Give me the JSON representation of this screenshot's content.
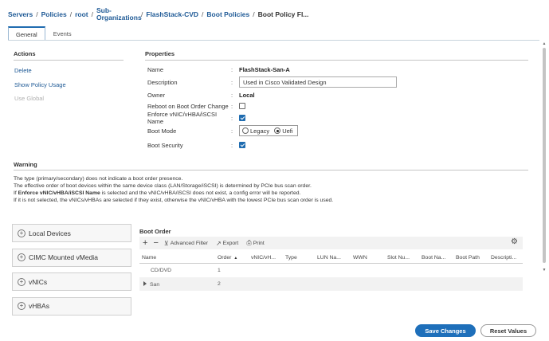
{
  "breadcrumb": {
    "items": [
      "Servers",
      "Policies",
      "root",
      "Sub-",
      "Organizations",
      "FlashStack-CVD",
      "Boot Policies",
      "Boot Policy Fl..."
    ]
  },
  "tabs": [
    {
      "label": "General",
      "active": true
    },
    {
      "label": "Events",
      "active": false
    }
  ],
  "actions": {
    "title": "Actions",
    "items": [
      {
        "label": "Delete",
        "enabled": true
      },
      {
        "label": "Show Policy Usage",
        "enabled": true
      },
      {
        "label": "Use Global",
        "enabled": false
      }
    ]
  },
  "properties": {
    "title": "Properties",
    "name_label": "Name",
    "name_value": "FlashStack-San-A",
    "description_label": "Description",
    "description_value": "Used in Cisco Validated Design",
    "owner_label": "Owner",
    "owner_value": "Local",
    "reboot_label": "Reboot on Boot Order Change",
    "reboot_checked": false,
    "enforce_label": "Enforce vNIC/vHBA/iSCSI Name",
    "enforce_checked": true,
    "boot_mode_label": "Boot Mode",
    "boot_mode_options": [
      "Legacy",
      "Uefi"
    ],
    "boot_mode_selected": "Uefi",
    "boot_security_label": "Boot Security",
    "boot_security_checked": true,
    "colon": ":"
  },
  "warning": {
    "title": "Warning",
    "line1": "The type (primary/secondary) does not indicate a boot order presence.",
    "line2": "The effective order of boot devices within the same device class (LAN/Storage/iSCSI) is determined by PCIe bus scan order.",
    "line3_pre": "If ",
    "line3_bold": "Enforce vNIC/vHBA/iSCSI Name",
    "line3_post": " is selected and the vNIC/vHBA/iSCSI does not exist, a config error will be reported.",
    "line4": "If it is not selected, the vNICs/vHBAs are selected if they exist, otherwise the vNIC/vHBA with the lowest PCIe bus scan order is used."
  },
  "devices": {
    "items": [
      "Local Devices",
      "CIMC Mounted vMedia",
      "vNICs",
      "vHBAs"
    ]
  },
  "boot_order": {
    "title": "Boot Order",
    "toolbar": {
      "add": "+",
      "remove": "−",
      "filter": "Advanced Filter",
      "export": "Export",
      "print": "Print"
    },
    "columns": [
      "Name",
      "Order",
      "vNIC/vH...",
      "Type",
      "LUN Na...",
      "WWN",
      "Slot Nu...",
      "Boot Na...",
      "Boot Path",
      "Descripti..."
    ],
    "rows": [
      {
        "name": "CD/DVD",
        "order": "1",
        "expandable": false
      },
      {
        "name": "San",
        "order": "2",
        "expandable": true
      }
    ]
  },
  "buttons": {
    "save": "Save Changes",
    "reset": "Reset Values"
  },
  "colors": {
    "accent": "#1e6fba",
    "link": "#1f5a96"
  }
}
